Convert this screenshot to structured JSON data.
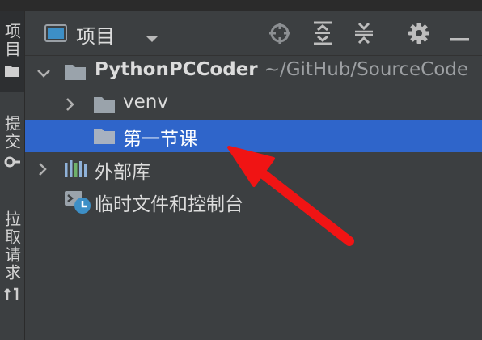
{
  "left_bar": {
    "tabs": [
      {
        "label": "项目",
        "icon": "folder-icon"
      },
      {
        "label": "提交",
        "icon": "commit-icon"
      },
      {
        "label": "拉取请求",
        "icon": "pull-request-icon"
      }
    ]
  },
  "header": {
    "title": "项目",
    "icons": [
      "project-view-icon",
      "chevron-down-icon",
      "crosshair-icon",
      "expand-all-icon",
      "collapse-all-icon",
      "gear-icon",
      "minimize-icon"
    ]
  },
  "tree": {
    "root": {
      "name": "PythonPCCoder",
      "path": "~/GitHub/SourceCode"
    },
    "items": [
      {
        "name": "venv",
        "type": "folder"
      },
      {
        "name": "第一节课",
        "type": "folder",
        "selected": true
      },
      {
        "name": "外部库",
        "type": "libraries"
      },
      {
        "name": "临时文件和控制台",
        "type": "scratches"
      }
    ]
  },
  "colors": {
    "background": "#3c3f41",
    "selection": "#2f65ca",
    "arrow": "#f01414"
  }
}
